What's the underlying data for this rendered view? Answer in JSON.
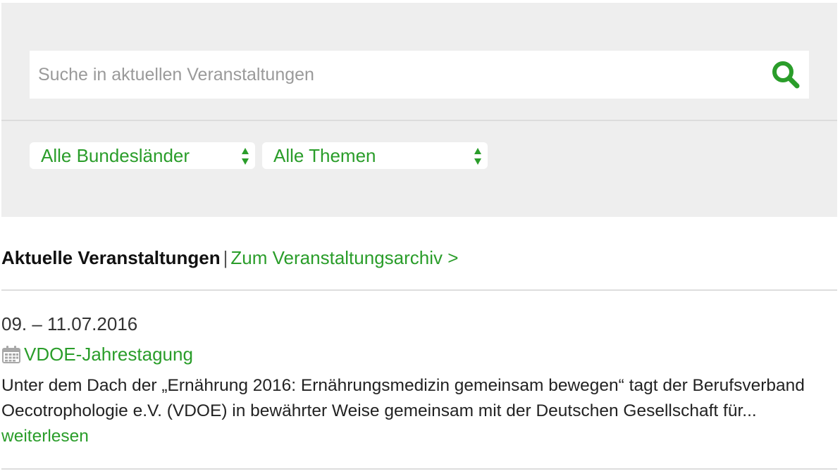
{
  "search": {
    "placeholder": "Suche in aktuellen Veranstaltungen",
    "icon": "search-icon"
  },
  "filters": {
    "bundeslaender": {
      "selected": "Alle Bundesländer"
    },
    "themen": {
      "selected": "Alle Themen"
    }
  },
  "listing": {
    "heading": "Aktuelle Veranstaltungen",
    "separator": "|",
    "archive_link": "Zum Veranstaltungsarchiv >"
  },
  "events": [
    {
      "date": "09. – 11.07.2016",
      "icon": "calendar-icon",
      "title": "VDOE-Jahrestagung",
      "teaser": "Unter dem Dach der „Ernährung 2016: Ernährungsmedizin gemeinsam bewegen“ tagt der Berufsverband Oecotrophologie e.V. (VDOE) in bewährter Weise gemeinsam mit der Deutschen Gesellschaft für...",
      "read_more": "weiterlesen"
    }
  ],
  "colors": {
    "accent": "#2a9d2a",
    "panel_bg": "#eeeeee",
    "divider": "#dddddd"
  }
}
